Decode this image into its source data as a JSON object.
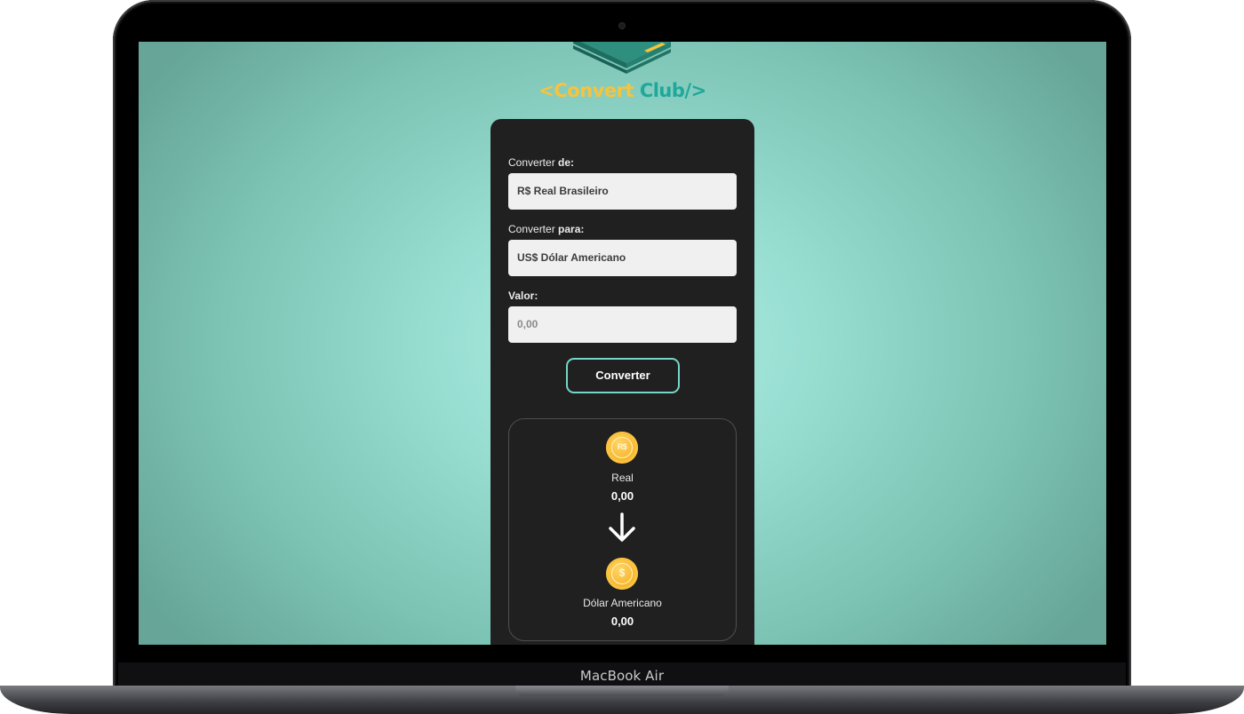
{
  "device": {
    "label": "MacBook Air"
  },
  "logo": {
    "part1": "<Convert",
    "part2": " Club/>"
  },
  "form": {
    "from_label_prefix": "Converter ",
    "from_label_strong": "de:",
    "from_value": "R$ Real Brasileiro",
    "to_label_prefix": "Converter ",
    "to_label_strong": "para:",
    "to_value": "US$ Dólar Americano",
    "amount_label": "Valor:",
    "amount_placeholder": "0,00",
    "convert_button": "Converter"
  },
  "result": {
    "from_coin_symbol": "R$",
    "from_currency": "Real",
    "from_value": "0,00",
    "to_coin_symbol": "$",
    "to_currency": "Dólar Americano",
    "to_value": "0,00"
  },
  "colors": {
    "accent": "#77d6c5",
    "card_bg": "#202020",
    "logo_yellow": "#f7c33c",
    "logo_teal": "#1fa89a",
    "coin_gold": "#f5b42a"
  },
  "icons": {
    "logo": "money-stack-icon",
    "from_coin": "real-coin-icon",
    "to_coin": "dollar-coin-icon",
    "arrow": "arrow-down-icon"
  }
}
